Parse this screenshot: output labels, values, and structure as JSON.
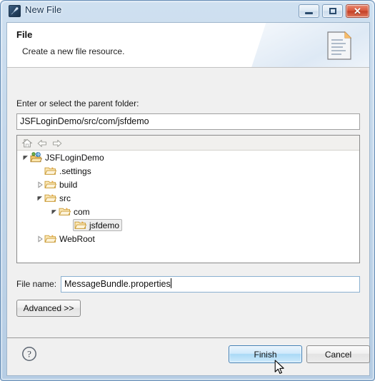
{
  "window": {
    "title": "New File",
    "icon": "new-file-icon",
    "buttons": {
      "minimize": "minimize",
      "maximize": "maximize",
      "close": "close"
    },
    "accent_blue": "#b6cde4",
    "frame_border": "#6f93b8"
  },
  "header": {
    "title": "File",
    "description": "Create a new file resource.",
    "icon": "document-page-icon"
  },
  "form": {
    "parent_folder_label": "Enter or select the parent folder:",
    "parent_folder_value": "JSFLoginDemo/src/com/jsfdemo",
    "file_name_label": "File name:",
    "file_name_value": "MessageBundle.properties",
    "advanced_label": "Advanced >>"
  },
  "tree": {
    "toolbar": [
      {
        "name": "home-icon",
        "label": "Home"
      },
      {
        "name": "back-arrow-icon",
        "label": "Back"
      },
      {
        "name": "forward-arrow-icon",
        "label": "Forward"
      }
    ],
    "nodes": [
      {
        "label": "JSFLoginDemo",
        "indent": 0,
        "twisty": "expanded",
        "icon": "project-icon",
        "selected": false
      },
      {
        "label": ".settings",
        "indent": 1,
        "twisty": "none",
        "icon": "folder-icon",
        "selected": false
      },
      {
        "label": "build",
        "indent": 1,
        "twisty": "collapsed",
        "icon": "folder-icon",
        "selected": false
      },
      {
        "label": "src",
        "indent": 1,
        "twisty": "expanded",
        "icon": "folder-icon",
        "selected": false
      },
      {
        "label": "com",
        "indent": 2,
        "twisty": "expanded",
        "icon": "folder-icon",
        "selected": false
      },
      {
        "label": "jsfdemo",
        "indent": 3,
        "twisty": "none",
        "icon": "folder-icon",
        "selected": true
      },
      {
        "label": "WebRoot",
        "indent": 1,
        "twisty": "collapsed",
        "icon": "folder-icon",
        "selected": false
      }
    ]
  },
  "footer": {
    "help_icon": "help-question-icon",
    "finish_label": "Finish",
    "cancel_label": "Cancel"
  }
}
